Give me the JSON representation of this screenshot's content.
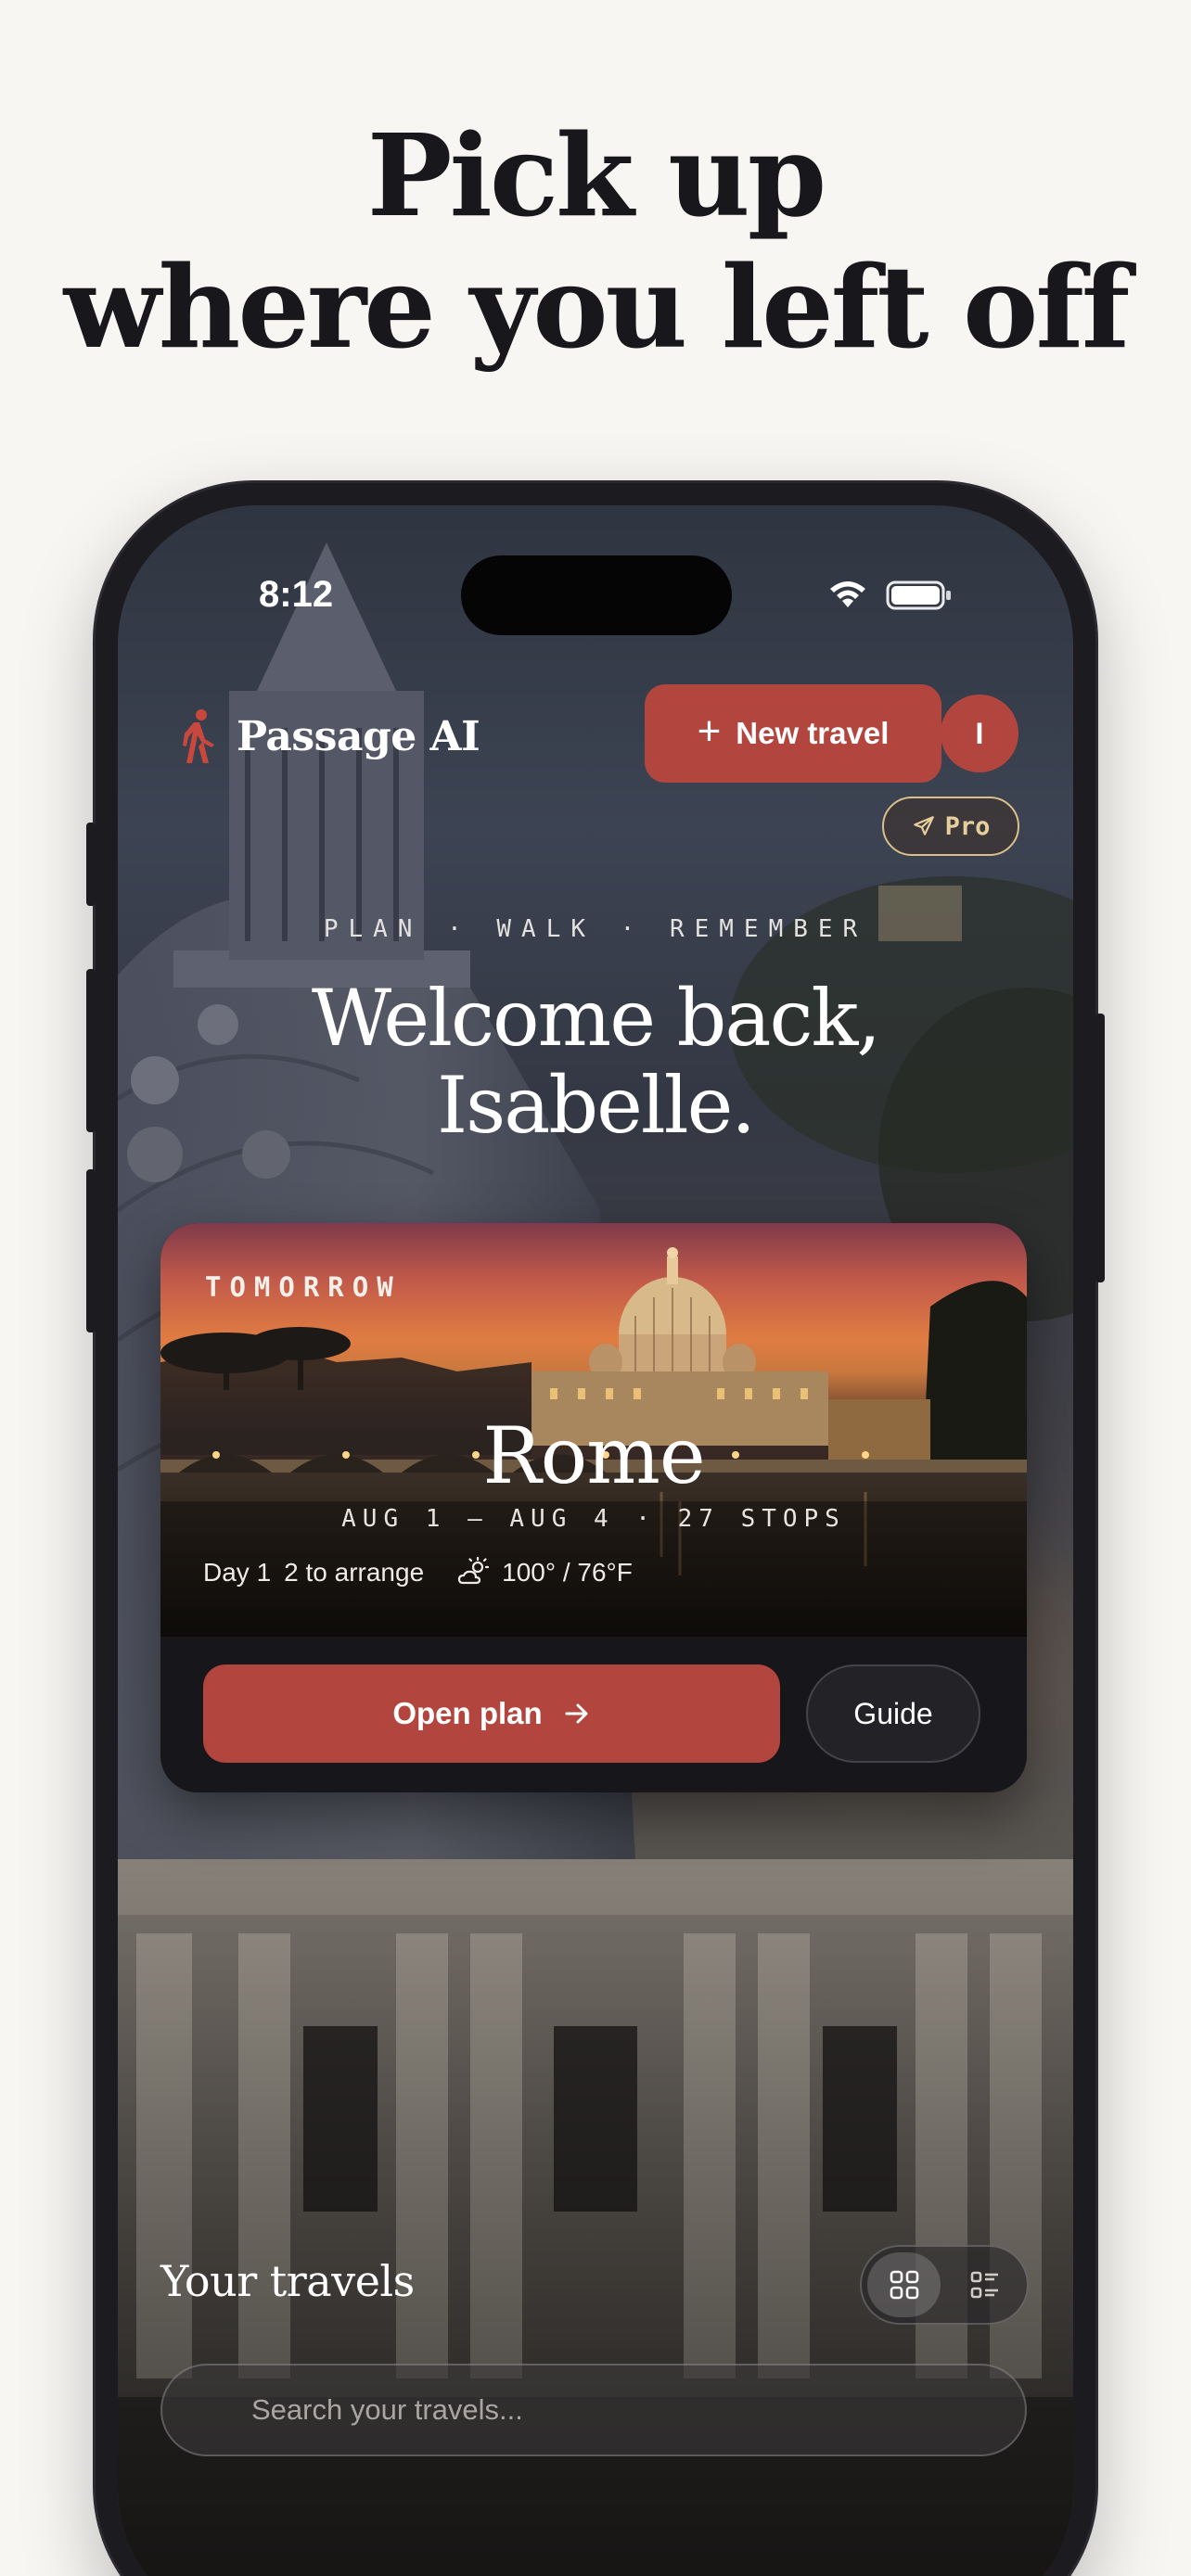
{
  "headline": {
    "line1": "Pick up",
    "line2": "where you left off"
  },
  "status_bar": {
    "time": "8:12",
    "icons": [
      "wifi-icon",
      "battery-icon"
    ]
  },
  "header": {
    "brand_name": "Passage AI",
    "brand_icon": "hiker-icon",
    "new_travel_label": "New travel",
    "avatar_initial": "I",
    "pro_label": "Pro"
  },
  "welcome": {
    "tagline": "PLAN · WALK · REMEMBER",
    "line1": "Welcome back,",
    "line2": "Isabelle."
  },
  "trip": {
    "label": "TOMORROW",
    "city": "Rome",
    "dates": "AUG 1 – AUG 4 · 27 STOPS",
    "day": "Day 1",
    "arrange": "2 to arrange",
    "weather": "100° / 76°F",
    "open_plan_label": "Open plan",
    "guide_label": "Guide"
  },
  "travels": {
    "title": "Your travels",
    "search_placeholder": "Search your travels..."
  },
  "colors": {
    "accent": "#b2463f",
    "pro_gold": "#d9bf8a",
    "page_bg": "#f7f6f3",
    "headline": "#18171c"
  }
}
